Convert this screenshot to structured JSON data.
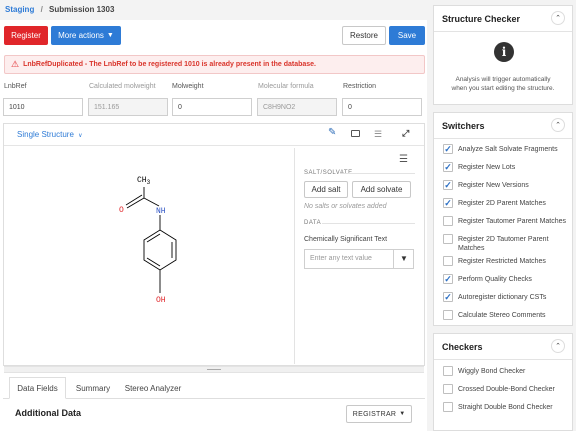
{
  "breadcrumb": {
    "root": "Staging",
    "sep": "/",
    "current": "Submission 1303"
  },
  "toolbar": {
    "register": "Register",
    "more_actions": "More actions",
    "restore": "Restore",
    "save": "Save"
  },
  "alert": {
    "text": "LnbRefDuplicated - The LnbRef to be registered 1010 is already present in the database."
  },
  "fields": [
    {
      "label": "LnbRef",
      "value": "1010",
      "disabled": false
    },
    {
      "label": "Calculated molweight",
      "value": "151.165",
      "disabled": true
    },
    {
      "label": "Molweight",
      "value": "0",
      "disabled": false
    },
    {
      "label": "Molecular formula",
      "value": "C8H9NO2",
      "disabled": true
    },
    {
      "label": "Restriction",
      "value": "0",
      "disabled": false
    }
  ],
  "structure": {
    "mode": "Single Structure",
    "atoms": {
      "methyl": "CH",
      "methyl_sub": "3",
      "oxygen": "O",
      "nh": "NH",
      "oh": "OH"
    }
  },
  "salt": {
    "section": "SALT/SOLVATE",
    "add_salt": "Add salt",
    "add_solvate": "Add solvate",
    "empty": "No salts or solvates added",
    "data_section": "DATA",
    "field_label": "Chemically Significant Text",
    "placeholder": "Enter any text value"
  },
  "bottom_tabs": [
    "Data Fields",
    "Summary",
    "Stereo Analyzer"
  ],
  "additional": {
    "title": "Additional Data",
    "registrar": "REGISTRAR"
  },
  "structure_checker": {
    "title": "Structure Checker",
    "message_line1": "Analysis will trigger automatically",
    "message_line2": "when you start editing the structure."
  },
  "switchers": {
    "title": "Switchers",
    "items": [
      {
        "label": "Analyze Salt Solvate Fragments",
        "checked": true
      },
      {
        "label": "Register New Lots",
        "checked": true
      },
      {
        "label": "Register New Versions",
        "checked": true
      },
      {
        "label": "Register 2D Parent Matches",
        "checked": true
      },
      {
        "label": "Register Tautomer Parent Matches",
        "checked": false
      },
      {
        "label": "Register 2D Tautomer Parent",
        "label2": "Matches",
        "checked": false
      },
      {
        "label": "Register Restricted Matches",
        "checked": false
      },
      {
        "label": "Perform Quality Checks",
        "checked": true
      },
      {
        "label": "Autoregister dictionary CSTs",
        "checked": true
      },
      {
        "label": "Calculate Stereo Comments",
        "checked": false
      }
    ]
  },
  "checkers": {
    "title": "Checkers",
    "items": [
      {
        "label": "Wiggly Bond Checker",
        "checked": false
      },
      {
        "label": "Crossed Double-Bond Checker",
        "checked": false
      },
      {
        "label": "Straight Double Bond Checker",
        "checked": false
      }
    ]
  },
  "colors": {
    "accent": "#2e7bd6",
    "danger": "#e0262a"
  }
}
